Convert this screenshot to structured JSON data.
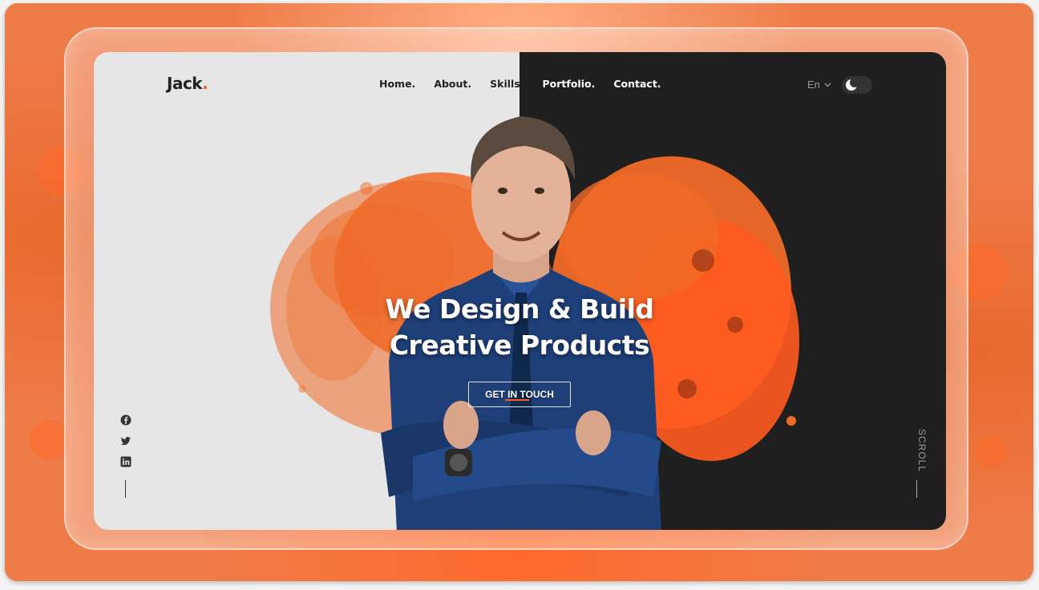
{
  "header": {
    "logo_text": "Jack",
    "logo_dot": ".",
    "nav": [
      {
        "label": "Home."
      },
      {
        "label": "About."
      },
      {
        "label": "Skills."
      },
      {
        "label": "Portfolio."
      },
      {
        "label": "Contact."
      }
    ],
    "language": "En",
    "theme_toggle_icon": "moon-icon"
  },
  "hero": {
    "headline_line1": "We Design & Build",
    "headline_line2": "Creative Products",
    "cta_label": "GET IN TOUCH"
  },
  "social": {
    "icons": [
      "facebook-icon",
      "twitter-icon",
      "linkedin-icon"
    ]
  },
  "scroll_label": "SCROLL",
  "colors": {
    "accent": "#ff5a1f",
    "dark_bg": "#1f1f1f",
    "light_bg": "#e6e6e6",
    "shirt": "#1e3f78"
  }
}
